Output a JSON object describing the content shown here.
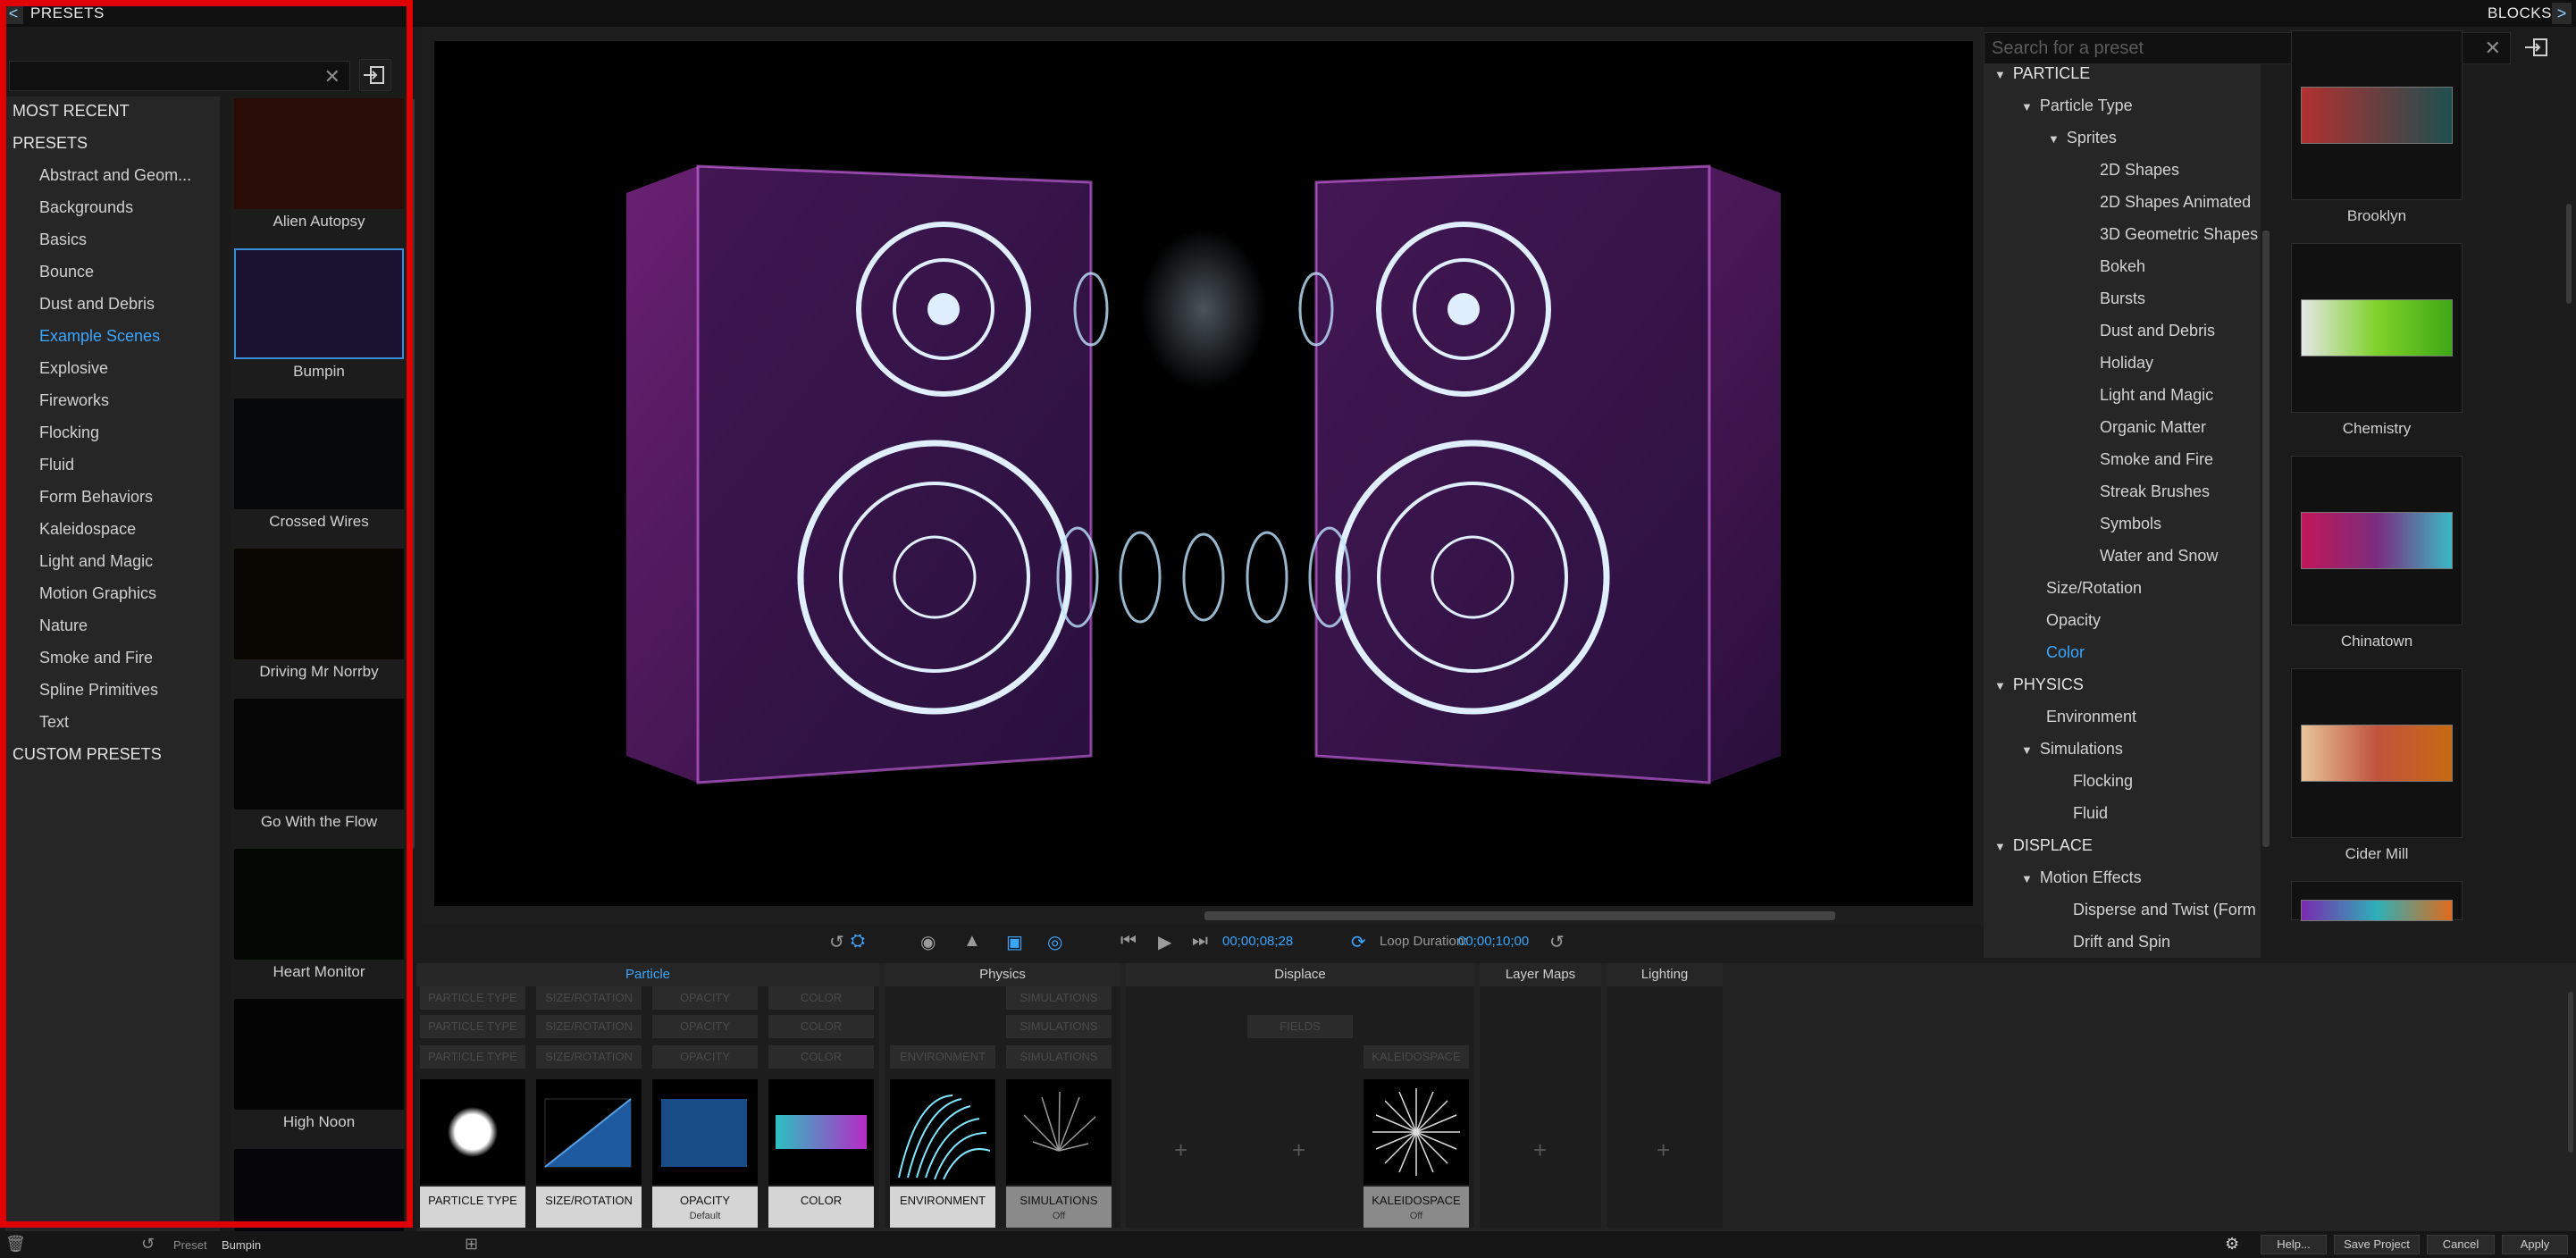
{
  "topbar": {
    "left_title": "PRESETS",
    "right_title": "BLOCKS",
    "collapse_left_glyph": "<",
    "collapse_right_glyph": ">"
  },
  "presets": {
    "search_placeholder": "",
    "categories": [
      {
        "label": "MOST RECENT",
        "level": 0
      },
      {
        "label": "PRESETS",
        "level": 0
      },
      {
        "label": "Abstract and Geom...",
        "level": 1
      },
      {
        "label": "Backgrounds",
        "level": 1
      },
      {
        "label": "Basics",
        "level": 1
      },
      {
        "label": "Bounce",
        "level": 1
      },
      {
        "label": "Dust and Debris",
        "level": 1
      },
      {
        "label": "Example Scenes",
        "level": 1,
        "active": true
      },
      {
        "label": "Explosive",
        "level": 1
      },
      {
        "label": "Fireworks",
        "level": 1
      },
      {
        "label": "Flocking",
        "level": 1
      },
      {
        "label": "Fluid",
        "level": 1
      },
      {
        "label": "Form Behaviors",
        "level": 1
      },
      {
        "label": "Kaleidospace",
        "level": 1
      },
      {
        "label": "Light and Magic",
        "level": 1
      },
      {
        "label": "Motion Graphics",
        "level": 1
      },
      {
        "label": "Nature",
        "level": 1
      },
      {
        "label": "Smoke and Fire",
        "level": 1
      },
      {
        "label": "Spline Primitives",
        "level": 1
      },
      {
        "label": "Text",
        "level": 1
      },
      {
        "label": "CUSTOM PRESETS",
        "level": 0
      }
    ],
    "thumbnails": [
      {
        "label": "Alien Autopsy"
      },
      {
        "label": "Bumpin",
        "selected": true
      },
      {
        "label": "Crossed Wires"
      },
      {
        "label": "Driving Mr Norrby"
      },
      {
        "label": "Go With the Flow"
      },
      {
        "label": "Heart Monitor"
      },
      {
        "label": "High Noon"
      }
    ]
  },
  "transport": {
    "current_time": "00;00;08;28",
    "loop_label": "Loop Duration:",
    "loop_time": "00;00;10;00"
  },
  "blocks": {
    "search_placeholder": "Search for a preset",
    "tree": [
      {
        "label": "PARTICLE",
        "indent": 0,
        "caret": true,
        "head": true
      },
      {
        "label": "Particle Type",
        "indent": 1,
        "caret": true
      },
      {
        "label": "Sprites",
        "indent": 2,
        "caret": true
      },
      {
        "label": "2D Shapes",
        "indent": 3
      },
      {
        "label": "2D Shapes Animated",
        "indent": 3
      },
      {
        "label": "3D Geometric Shapes",
        "indent": 3
      },
      {
        "label": "Bokeh",
        "indent": 3
      },
      {
        "label": "Bursts",
        "indent": 3
      },
      {
        "label": "Dust and Debris",
        "indent": 3
      },
      {
        "label": "Holiday",
        "indent": 3
      },
      {
        "label": "Light and Magic",
        "indent": 3
      },
      {
        "label": "Organic Matter",
        "indent": 3
      },
      {
        "label": "Smoke and Fire",
        "indent": 3
      },
      {
        "label": "Streak Brushes",
        "indent": 3
      },
      {
        "label": "Symbols",
        "indent": 3
      },
      {
        "label": "Water and Snow",
        "indent": 3
      },
      {
        "label": "Size/Rotation",
        "indent": 1
      },
      {
        "label": "Opacity",
        "indent": 1
      },
      {
        "label": "Color",
        "indent": 1,
        "active": true
      },
      {
        "label": "PHYSICS",
        "indent": 0,
        "caret": true,
        "head": true
      },
      {
        "label": "Environment",
        "indent": 1
      },
      {
        "label": "Simulations",
        "indent": 1,
        "caret": true
      },
      {
        "label": "Flocking",
        "indent": 2
      },
      {
        "label": "Fluid",
        "indent": 2
      },
      {
        "label": "DISPLACE",
        "indent": 0,
        "caret": true,
        "head": true
      },
      {
        "label": "Motion Effects",
        "indent": 1,
        "caret": true
      },
      {
        "label": "Disperse and Twist (Form C",
        "indent": 2
      },
      {
        "label": "Drift and Spin",
        "indent": 2
      }
    ],
    "swatches": [
      {
        "label": "Brooklyn",
        "gradient": [
          "#b23030",
          "#1e4f4f"
        ]
      },
      {
        "label": "Chemistry",
        "gradient": [
          "#e6e6e6",
          "#7fd22a",
          "#3fa815"
        ]
      },
      {
        "label": "Chinatown",
        "gradient": [
          "#c2175a",
          "#7a2c7e",
          "#3bb9c4"
        ]
      },
      {
        "label": "Cider Mill",
        "gradient": [
          "#e8c49a",
          "#c0533c",
          "#c76a14"
        ]
      },
      {
        "label": "",
        "gradient": [
          "#7a2ab0",
          "#2db0b8",
          "#e06a1a"
        ]
      }
    ]
  },
  "tabs": [
    {
      "label": "Particle",
      "active": true
    },
    {
      "label": "Physics"
    },
    {
      "label": "Displace"
    },
    {
      "label": "Layer Maps"
    },
    {
      "label": "Lighting"
    }
  ],
  "block_cards": [
    {
      "label": "PARTICLE TYPE",
      "sub": ""
    },
    {
      "label": "SIZE/ROTATION",
      "sub": ""
    },
    {
      "label": "OPACITY",
      "sub": "Default"
    },
    {
      "label": "COLOR",
      "sub": ""
    },
    {
      "label": "ENVIRONMENT",
      "sub": ""
    },
    {
      "label": "SIMULATIONS",
      "sub": "Off"
    },
    {
      "label": "KALEIDOSPACE",
      "sub": "Off"
    }
  ],
  "ghost_rows": {
    "particle": [
      "PARTICLE TYPE",
      "SIZE/ROTATION",
      "OPACITY",
      "COLOR"
    ],
    "environment": "ENVIRONMENT",
    "simulations": "SIMULATIONS",
    "fields": "FIELDS",
    "kaleidospace": "KALEIDOSPACE"
  },
  "status": {
    "preset_label": "Preset",
    "preset_name": "Bumpin",
    "help": "Help...",
    "save_project": "Save Project",
    "cancel": "Cancel",
    "apply": "Apply"
  }
}
